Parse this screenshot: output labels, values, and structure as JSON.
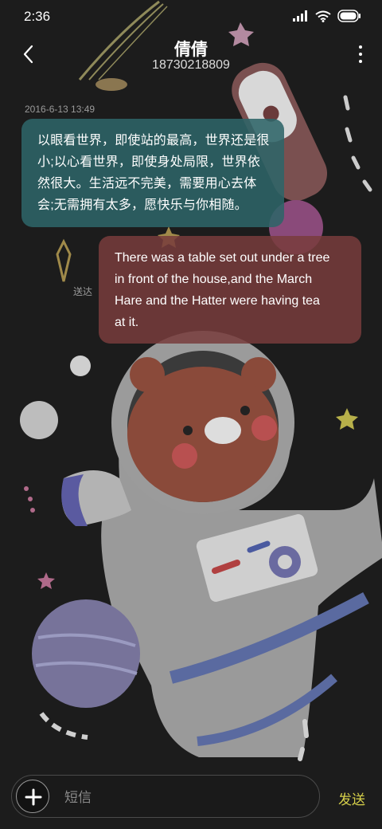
{
  "status_bar": {
    "time": "2:36",
    "icons": [
      "signal-icon",
      "wifi-icon",
      "battery-icon"
    ]
  },
  "header": {
    "contact_name": "倩倩",
    "phone_number": "18730218809",
    "back_icon": "chevron-left-icon",
    "more_icon": "more-vertical-icon"
  },
  "conversation": {
    "timestamp": "2016-6-13 13:49",
    "messages": [
      {
        "direction": "incoming",
        "lines": [
          "以眼看世界，即使站的最高，世界还是很",
          "小;以心看世界，即使身处局限，世界依",
          "然很大。生活远不完美，需要用心去体",
          "会;无需拥有太多，愿快乐与你相随。"
        ]
      },
      {
        "direction": "outgoing",
        "lines": [
          "There was a table set out under a tree",
          "in front of the house,and the March",
          "Hare and the Hatter were having tea",
          "at it."
        ],
        "status": "送达"
      }
    ]
  },
  "composer": {
    "add_icon": "plus-icon",
    "placeholder": "短信",
    "value": "",
    "send_label": "发送"
  },
  "colors": {
    "incoming_bubble": "#2e6468",
    "outgoing_bubble": "#783c3c",
    "send_accent": "#d6d04a",
    "background": "#1c1c1c"
  }
}
